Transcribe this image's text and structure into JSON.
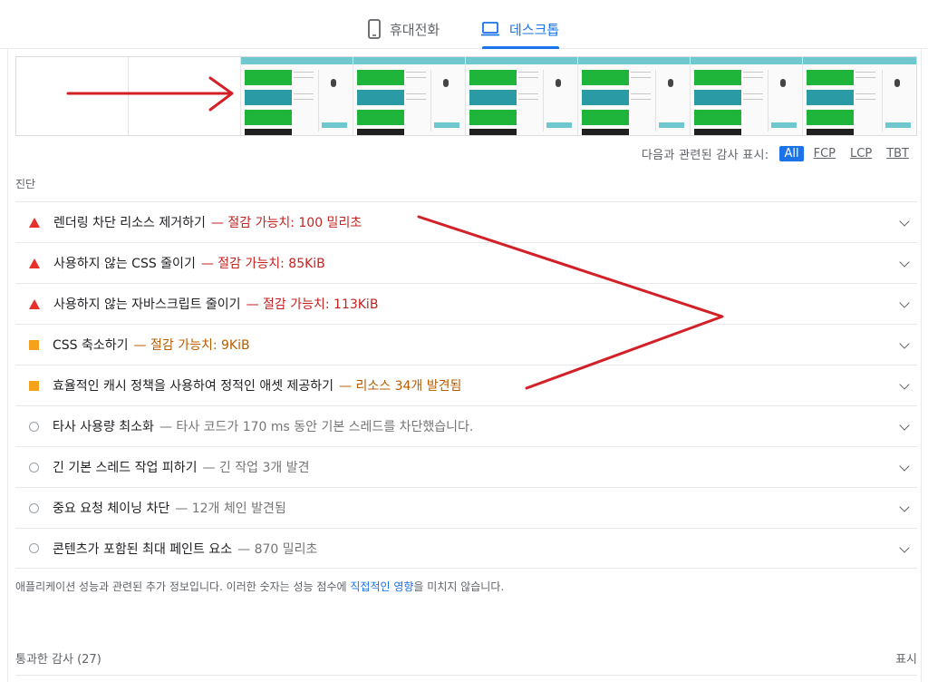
{
  "tabs": {
    "mobile": {
      "label": "휴대전화",
      "icon": "smartphone-icon"
    },
    "desktop": {
      "label": "데스크톱",
      "icon": "laptop-icon",
      "selected": true
    }
  },
  "filter": {
    "label": "다음과 관련된 감사 표시:",
    "options": [
      "All",
      "FCP",
      "LCP",
      "TBT"
    ],
    "selected": "All"
  },
  "diagnostics": {
    "heading": "진단",
    "audits": [
      {
        "rating": "fail",
        "title": "렌더링 차단 리소스 제거하기",
        "detail": "— 절감 가능치: 100 밀리초"
      },
      {
        "rating": "fail",
        "title": "사용하지 않는 CSS 줄이기",
        "detail": "— 절감 가능치: 85KiB"
      },
      {
        "rating": "fail",
        "title": "사용하지 않는 자바스크립트 줄이기",
        "detail": "— 절감 가능치: 113KiB"
      },
      {
        "rating": "average",
        "title": "CSS 축소하기",
        "detail": "— 절감 가능치: 9KiB"
      },
      {
        "rating": "average",
        "title": "효율적인 캐시 정책을 사용하여 정적인 애셋 제공하기",
        "detail": "— 리소스 34개 발견됨"
      },
      {
        "rating": "info",
        "title": "타사 사용량 최소화",
        "detail": "— 타사 코드가 170 ms 동안 기본 스레드를 차단했습니다."
      },
      {
        "rating": "info",
        "title": "긴 기본 스레드 작업 피하기",
        "detail": "— 긴 작업 3개 발견"
      },
      {
        "rating": "info",
        "title": "중요 요청 체이닝 차단",
        "detail": "— 12개 체인 발견됨"
      },
      {
        "rating": "info",
        "title": "콘텐츠가 포함된 최대 페인트 요소",
        "detail": "— 870 밀리초"
      }
    ],
    "note_prefix": "애플리케이션 성능과 관련된 추가 정보입니다. 이러한 숫자는 성능 점수에 ",
    "note_link": "직접적인 영향",
    "note_suffix": "을 미치지 않습니다."
  },
  "passed": {
    "label": "통과한 감사",
    "count": "(27)",
    "toggle": "표시"
  },
  "colors": {
    "accent": "#1a73e8",
    "fail": "#e8302b",
    "average": "#f4a21c",
    "annotation_arrow": "#d32027"
  }
}
